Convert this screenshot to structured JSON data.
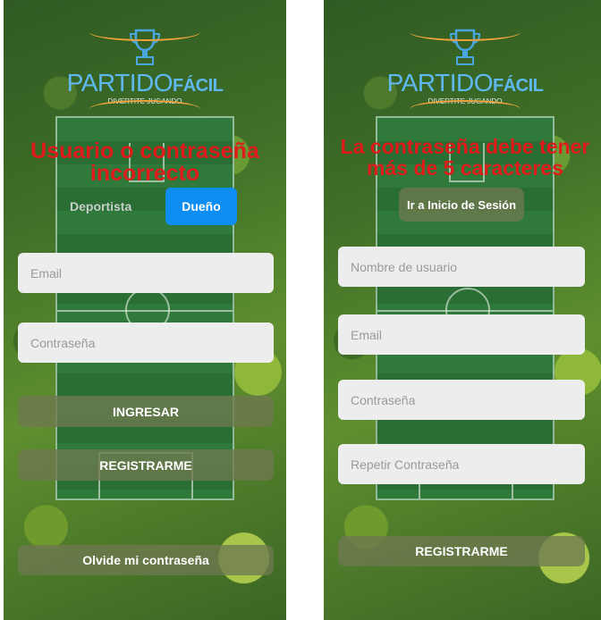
{
  "login_screen": {
    "logo": {
      "brand_light": "PARTIDO",
      "brand_bold": "FÁCIL",
      "tagline": "DIVERTITE JUGANDO"
    },
    "error_message": "Usuario o contraseña incorrecto",
    "role_tabs": [
      {
        "label": "Deportista"
      },
      {
        "label": "Dueño"
      }
    ],
    "email": {
      "placeholder": "Email",
      "value": ""
    },
    "password": {
      "placeholder": "Contraseña",
      "value": ""
    },
    "login_button": "INGRESAR",
    "register_button": "REGISTRARME",
    "forgot_link": "Olvide mi contraseña"
  },
  "register_screen": {
    "logo": {
      "brand_light": "PARTIDO",
      "brand_bold": "FÁCIL",
      "tagline": "DIVERTITE JUGANDO"
    },
    "error_message": "La contraseña debe tener más de 5 caracteres",
    "go_login_button": "Ir a Inicio de Sesión",
    "username": {
      "placeholder": "Nombre de usuario",
      "value": ""
    },
    "email": {
      "placeholder": "Email",
      "value": ""
    },
    "password": {
      "placeholder": "Contraseña",
      "value": ""
    },
    "repeat_password": {
      "placeholder": "Repetir Contraseña",
      "value": ""
    },
    "register_button": "REGISTRARME"
  },
  "colors": {
    "error_red": "#e01b1b",
    "active_tab_blue": "#0e8ef2",
    "logo_blue": "#5fb8ef",
    "accent_orange": "#f2a23a"
  },
  "icons": {
    "logo": "trophy-icon"
  }
}
